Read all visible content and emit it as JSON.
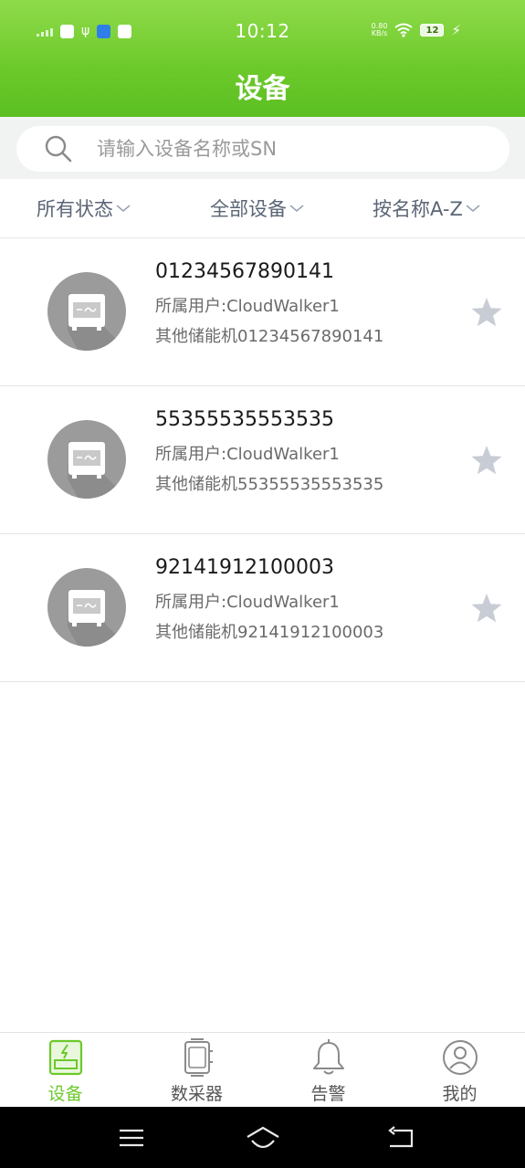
{
  "status_bar": {
    "time": "10:12",
    "net_speed_value": "0.80",
    "net_speed_unit": "KB/s",
    "battery": "12"
  },
  "header": {
    "title": "设备"
  },
  "search": {
    "placeholder": "请输入设备名称或SN"
  },
  "filters": [
    {
      "label": "所有状态"
    },
    {
      "label": "全部设备"
    },
    {
      "label": "按名称A-Z"
    }
  ],
  "devices": [
    {
      "name": "01234567890141",
      "user": "所属用户:CloudWalker1",
      "type": "其他储能机01234567890141"
    },
    {
      "name": "55355535553535",
      "user": "所属用户:CloudWalker1",
      "type": "其他储能机55355535553535"
    },
    {
      "name": "92141912100003",
      "user": "所属用户:CloudWalker1",
      "type": "其他储能机92141912100003"
    }
  ],
  "bottom_nav": [
    {
      "label": "设备",
      "icon": "device-icon",
      "active": true
    },
    {
      "label": "数采器",
      "icon": "collector-icon",
      "active": false
    },
    {
      "label": "告警",
      "icon": "bell-icon",
      "active": false
    },
    {
      "label": "我的",
      "icon": "profile-icon",
      "active": false
    }
  ],
  "colors": {
    "brand_green": "#6cc92a",
    "star_gray": "#c8ccd4",
    "filter_text": "#5a6575"
  }
}
